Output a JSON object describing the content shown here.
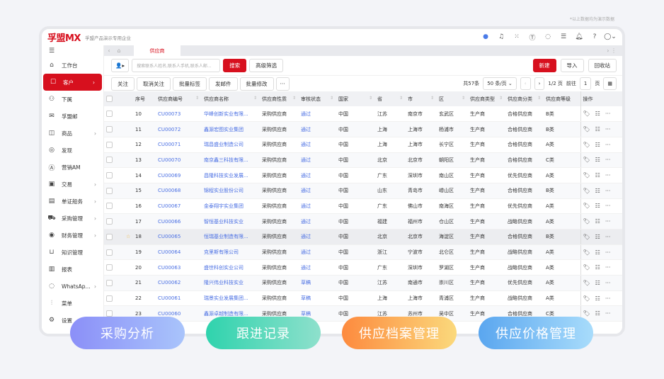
{
  "note": "*以上数据均为演示数据",
  "header": {
    "logo": "孚盟MX",
    "subtitle": "孚盟产品演示专用企业",
    "icons": [
      "ai-assistant-icon",
      "headset-icon",
      "apps-grid-icon",
      "translate-icon",
      "whatsapp-icon",
      "task-list-icon",
      "bell-icon",
      "help-icon",
      "avatar-icon"
    ]
  },
  "sidebar": {
    "items": [
      {
        "label": "工作台",
        "icon": "⌂",
        "name": "home"
      },
      {
        "label": "客户",
        "icon": "☐",
        "name": "customer",
        "active": true,
        "chev": true
      },
      {
        "label": "下属",
        "icon": "⚇",
        "name": "subordinate"
      },
      {
        "label": "孚盟邮",
        "icon": "✉",
        "name": "mail"
      },
      {
        "label": "商品",
        "icon": "◫",
        "name": "goods",
        "chev": true
      },
      {
        "label": "发现",
        "icon": "◎",
        "name": "discover"
      },
      {
        "label": "营销AM",
        "icon": "Ⓐ",
        "name": "marketing"
      },
      {
        "label": "交易",
        "icon": "▣",
        "name": "trade",
        "chev": true
      },
      {
        "label": "单证船务",
        "icon": "▤",
        "name": "documents",
        "chev": true
      },
      {
        "label": "采购管理",
        "icon": "⛟",
        "name": "purchase",
        "chev": true
      },
      {
        "label": "财务管理",
        "icon": "◉",
        "name": "finance",
        "chev": true
      },
      {
        "label": "知识管理",
        "icon": "⊔",
        "name": "knowledge"
      },
      {
        "label": "报表",
        "icon": "▥",
        "name": "reports"
      },
      {
        "label": "WhatsAp...",
        "icon": "◌",
        "name": "whatsapp",
        "chev": true
      },
      {
        "label": "菜单",
        "icon": "⫶",
        "name": "menu"
      },
      {
        "label": "设置",
        "icon": "⚙",
        "name": "settings"
      }
    ]
  },
  "tabs": {
    "active": "供应商"
  },
  "search": {
    "placeholder": "搜索联系人姓名,联系人手机,联系人邮...",
    "search_label": "搜索",
    "advanced_label": "高级筛选",
    "new_label": "新建",
    "import_label": "导入",
    "recycle_label": "回收站"
  },
  "toolbar": {
    "buttons": [
      "关注",
      "取消关注",
      "批量标签",
      "发邮件",
      "批量修改"
    ],
    "more": "···"
  },
  "pagination": {
    "total": "共57条",
    "page_size": "50 条/页",
    "page_info": "1/2 页",
    "goto_label": "前往",
    "goto_value": "1",
    "page_unit": "页"
  },
  "table": {
    "columns": [
      "序号",
      "供应商编号",
      "供应商名称",
      "供应商性质",
      "审核状态",
      "国家",
      "省",
      "市",
      "区",
      "供应商类型",
      "供应商分类",
      "供应商等级",
      "操作"
    ],
    "rows": [
      [
        "10",
        "CU00073",
        "华峰创新实业有限...",
        "采购供应商",
        "通过",
        "中国",
        "江苏",
        "南京市",
        "玄武区",
        "生产商",
        "合格供应商",
        "B类"
      ],
      [
        "11",
        "CU00072",
        "鑫源宏图实业集团",
        "采购供应商",
        "通过",
        "中国",
        "上海",
        "上海市",
        "杨浦市",
        "生产商",
        "合格供应商",
        "B类"
      ],
      [
        "12",
        "CU00071",
        "瑞昌盛业制造公司",
        "采购供应商",
        "通过",
        "中国",
        "上海",
        "上海市",
        "长宁区",
        "生产商",
        "合格供应商",
        "A类"
      ],
      [
        "13",
        "CU00070",
        "南京鑫三科技有限...",
        "采购供应商",
        "通过",
        "中国",
        "北京",
        "北京市",
        "朝阳区",
        "生产商",
        "合格供应商",
        "C类"
      ],
      [
        "14",
        "CU00069",
        "昌隆科技实业发展...",
        "采购供应商",
        "通过",
        "中国",
        "广东",
        "深圳市",
        "南山区",
        "生产商",
        "优先供应商",
        "A类"
      ],
      [
        "15",
        "CU00068",
        "锦程实业股份公司",
        "采购供应商",
        "通过",
        "中国",
        "山东",
        "青岛市",
        "崂山区",
        "生产商",
        "合格供应商",
        "B类"
      ],
      [
        "16",
        "CU00067",
        "金泰翔宇实业集团",
        "采购供应商",
        "通过",
        "中国",
        "广东",
        "佛山市",
        "南海区",
        "生产商",
        "优先供应商",
        "A类"
      ],
      [
        "17",
        "CU00066",
        "智恒基业科技实业",
        "采购供应商",
        "通过",
        "中国",
        "福建",
        "福州市",
        "仓山区",
        "生产商",
        "战略供应商",
        "A类"
      ],
      [
        "18",
        "CU00065",
        "恒瑞基业制造有限...",
        "采购供应商",
        "通过",
        "中国",
        "北京",
        "北京市",
        "海淀区",
        "生产商",
        "合格供应商",
        "B类"
      ],
      [
        "19",
        "CU00064",
        "克里斯有限公司",
        "采购供应商",
        "通过",
        "中国",
        "浙江",
        "宁波市",
        "北仑区",
        "生产商",
        "战略供应商",
        "A类"
      ],
      [
        "20",
        "CU00063",
        "盛世科创实业公司",
        "采购供应商",
        "通过",
        "中国",
        "广东",
        "深圳市",
        "罗湖区",
        "生产商",
        "战略供应商",
        "A类"
      ],
      [
        "21",
        "CU00062",
        "隆兴伟业科技实业",
        "采购供应商",
        "草稿",
        "中国",
        "江苏",
        "南通市",
        "崇川区",
        "生产商",
        "优先供应商",
        "A类"
      ],
      [
        "22",
        "CU00061",
        "瑞景实业发展集团...",
        "采购供应商",
        "草稿",
        "中国",
        "上海",
        "上海市",
        "青浦区",
        "生产商",
        "战略供应商",
        "A类"
      ],
      [
        "23",
        "CU00060",
        "鑫源卓越制造有限...",
        "采购供应商",
        "草稿",
        "中国",
        "江苏",
        "苏州市",
        "吴中区",
        "生产商",
        "合格供应商",
        "C类"
      ]
    ],
    "starred_row": "18"
  },
  "features": [
    {
      "label": "采购分析",
      "colors": [
        "#8b8ff8",
        "#a9c4fb"
      ]
    },
    {
      "label": "跟进记录",
      "colors": [
        "#2fd3ad",
        "#8ee0cc"
      ]
    },
    {
      "label": "供应档案管理",
      "colors": [
        "#fd8a3e",
        "#fbd97c"
      ]
    },
    {
      "label": "供应价格管理",
      "colors": [
        "#5aa6ef",
        "#a8dcfb"
      ]
    }
  ],
  "colors": {
    "brand": "#d7101e",
    "link": "#4a6fe3"
  }
}
